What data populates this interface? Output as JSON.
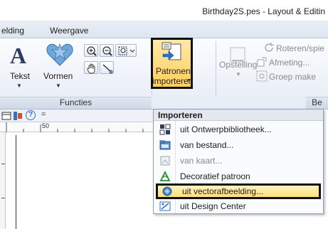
{
  "window": {
    "title": "Birthday2S.pes - Layout & Editin"
  },
  "ribbon_tabs": [
    "elding",
    "Weergave"
  ],
  "ribbon": {
    "text_label": "Tekst",
    "shapes_label": "Vormen",
    "functions_group": "Functies",
    "import_label_line1": "Patronen",
    "import_label_line2": "importeren",
    "arrange_label": "Opstelling",
    "rotate_label": "Roteren/spie",
    "measure_label": "Afmeting...",
    "group_label": "Groep make",
    "edit_group_partial": "Be"
  },
  "ruler": {
    "mark": "50"
  },
  "toolbar": {
    "help_glyph": "?",
    "dropdown_glyph": "="
  },
  "menu": {
    "header": "Importeren",
    "items": [
      {
        "label": "uit Ontwerpbibliotheek...",
        "icon": "library-icon",
        "enabled": true,
        "active": false
      },
      {
        "label": "van bestand...",
        "icon": "folder-icon",
        "enabled": true,
        "active": false
      },
      {
        "label": "van kaart...",
        "icon": "card-icon",
        "enabled": false,
        "active": false
      },
      {
        "label": "Decoratief patroon",
        "icon": "decorative-pattern-icon",
        "enabled": true,
        "active": false
      },
      {
        "label": "uit vectorafbeelding...",
        "icon": "vector-image-icon",
        "enabled": true,
        "active": true
      },
      {
        "label": "uit Design Center",
        "icon": "design-center-icon",
        "enabled": true,
        "active": false
      }
    ]
  },
  "colors": {
    "highlight": "#ffd25e",
    "menu_hover": "#ffe07a",
    "ribbon_bg": "#e6ecf5",
    "frame": "#111111"
  }
}
